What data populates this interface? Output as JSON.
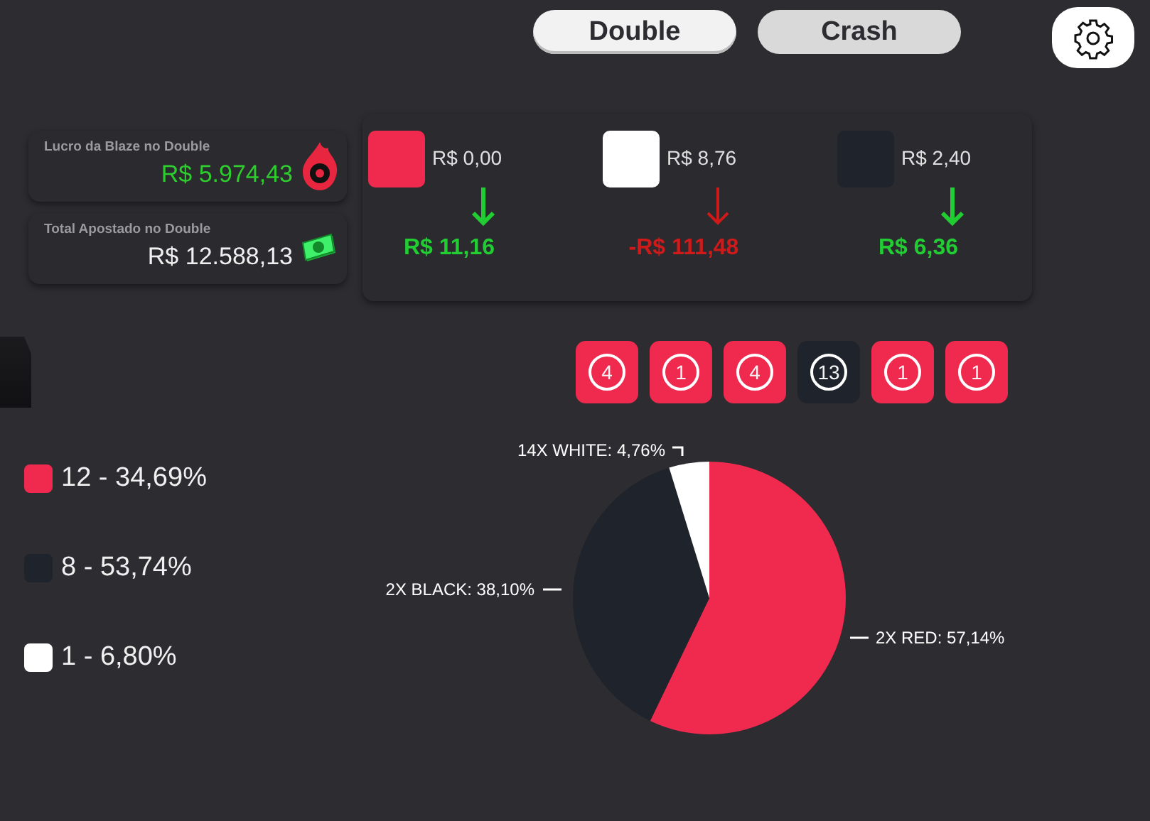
{
  "modes": [
    {
      "label": "Double",
      "selected": true
    },
    {
      "label": "Crash",
      "selected": false
    }
  ],
  "stats": [
    {
      "label": "Lucro da Blaze no Double",
      "value": "R$ 5.974,43",
      "color": "#2ecc2e",
      "kind": "flame"
    },
    {
      "label": "Total Apostado no Double",
      "value": "R$ 12.588,13",
      "color": "#f0f0f0",
      "kind": "money"
    }
  ],
  "bets": [
    {
      "color": "#f0294f",
      "amount": "R$ 0,00",
      "result": "R$ 11,16",
      "kind": "gain"
    },
    {
      "color": "#ffffff",
      "amount": "R$ 8,76",
      "result": "-R$ 111,48",
      "kind": "loss"
    },
    {
      "color": "#1f232b",
      "amount": "R$ 2,40",
      "result": "R$ 6,36",
      "kind": "gain"
    }
  ],
  "recent": [
    {
      "number": "4",
      "color": "#f0294f"
    },
    {
      "number": "1",
      "color": "#f0294f"
    },
    {
      "number": "4",
      "color": "#f0294f"
    },
    {
      "number": "13",
      "color": "#1f232b"
    },
    {
      "number": "1",
      "color": "#f0294f"
    },
    {
      "number": "1",
      "color": "#f0294f"
    }
  ],
  "legend": [
    {
      "color": "#f0294f",
      "text": "12 - 34,69%"
    },
    {
      "color": "#1f232b",
      "text": "8 - 53,74%"
    },
    {
      "color": "#ffffff",
      "text": "1 - 6,80%"
    }
  ],
  "pie": {
    "chart_data": {
      "type": "pie",
      "categories": [
        "2X RED: 57,14%",
        "2X BLACK: 38,10%",
        "14X WHITE: 4,76%"
      ],
      "colors": [
        "#f0294f",
        "#1f232b",
        "#ffffff"
      ],
      "values": [
        57.14,
        38.1,
        4.76
      ]
    }
  }
}
